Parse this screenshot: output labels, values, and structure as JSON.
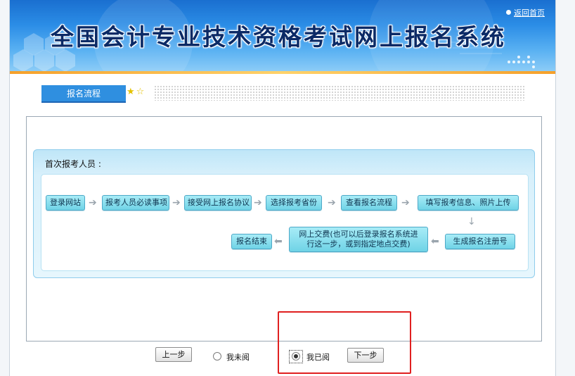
{
  "header": {
    "title": "全国会计专业技术资格考试网上报名系统",
    "home_link": "返回首页"
  },
  "nav": {
    "tab_label": "报名流程"
  },
  "flow": {
    "section_title": "首次报考人员 :",
    "row1": [
      "登录网站",
      "报考人员必读事项",
      "接受网上报名协议",
      "选择报考省份",
      "查看报名流程",
      "填写报考信息、照片上传"
    ],
    "row2": {
      "generate": "生成报名注册号",
      "payment_line1": "网上交费(也可以后登录报名系统进",
      "payment_line2": "行这一步，或到指定地点交费)",
      "end": "报名结束"
    }
  },
  "controls": {
    "prev_button": "上一步",
    "not_read_label": "我未阅",
    "read_label": "我已阅",
    "next_button": "下一步",
    "selected": "我已阅"
  },
  "colors": {
    "banner_blue": "#2b8de6",
    "tab_blue": "#2f8fe0",
    "step_cyan": "#6fd3e6",
    "highlight_red": "#e02020"
  }
}
